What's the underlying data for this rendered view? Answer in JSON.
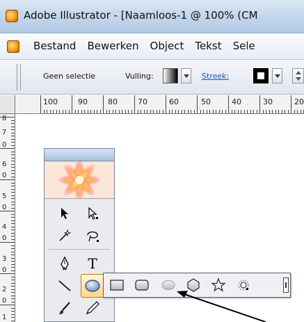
{
  "window": {
    "title": "Adobe Illustrator - [Naamloos-1 @ 100% (CM"
  },
  "menu": {
    "items": [
      "Bestand",
      "Bewerken",
      "Object",
      "Tekst",
      "Sele"
    ]
  },
  "controlbar": {
    "selection_label": "Geen selectie",
    "fill_label": "Vulling:",
    "stroke_label": "Streek:"
  },
  "ruler": {
    "horizontal_labels": [
      "100",
      "90",
      "80",
      "70",
      "60",
      "50",
      "40",
      "30",
      "20"
    ],
    "vertical_labels": [
      "8",
      "7",
      "0",
      "6",
      "0",
      "5",
      "0",
      "4",
      "0",
      "3",
      "0",
      "2",
      "0",
      "1"
    ]
  },
  "toolbox": {
    "tools": [
      {
        "name": "selection-tool",
        "icon": "black-arrow-icon"
      },
      {
        "name": "direct-selection-tool",
        "icon": "white-arrow-icon"
      },
      {
        "name": "magic-wand-tool",
        "icon": "magic-wand-icon"
      },
      {
        "name": "lasso-tool",
        "icon": "lasso-icon"
      },
      {
        "name": "pen-tool",
        "icon": "pen-icon"
      },
      {
        "name": "type-tool",
        "icon": "type-icon",
        "label": "T"
      },
      {
        "name": "line-tool",
        "icon": "line-icon"
      },
      {
        "name": "ellipse-tool",
        "icon": "ellipse-icon",
        "selected": true
      },
      {
        "name": "paintbrush-tool",
        "icon": "brush-icon"
      },
      {
        "name": "pencil-tool",
        "icon": "pencil-icon"
      }
    ]
  },
  "flyout": {
    "tools": [
      {
        "name": "rectangle-tool",
        "icon": "rectangle-icon"
      },
      {
        "name": "rounded-rectangle-tool",
        "icon": "rounded-rectangle-icon"
      },
      {
        "name": "ellipse-tool",
        "icon": "ellipse-icon"
      },
      {
        "name": "polygon-tool",
        "icon": "polygon-icon"
      },
      {
        "name": "star-tool",
        "icon": "star-icon"
      },
      {
        "name": "flare-tool",
        "icon": "flare-icon"
      }
    ]
  },
  "colors": {
    "titlebar": "#c3d6ec",
    "selected_tool": "#ffd78a",
    "stroke_link": "#1f4fc8"
  }
}
